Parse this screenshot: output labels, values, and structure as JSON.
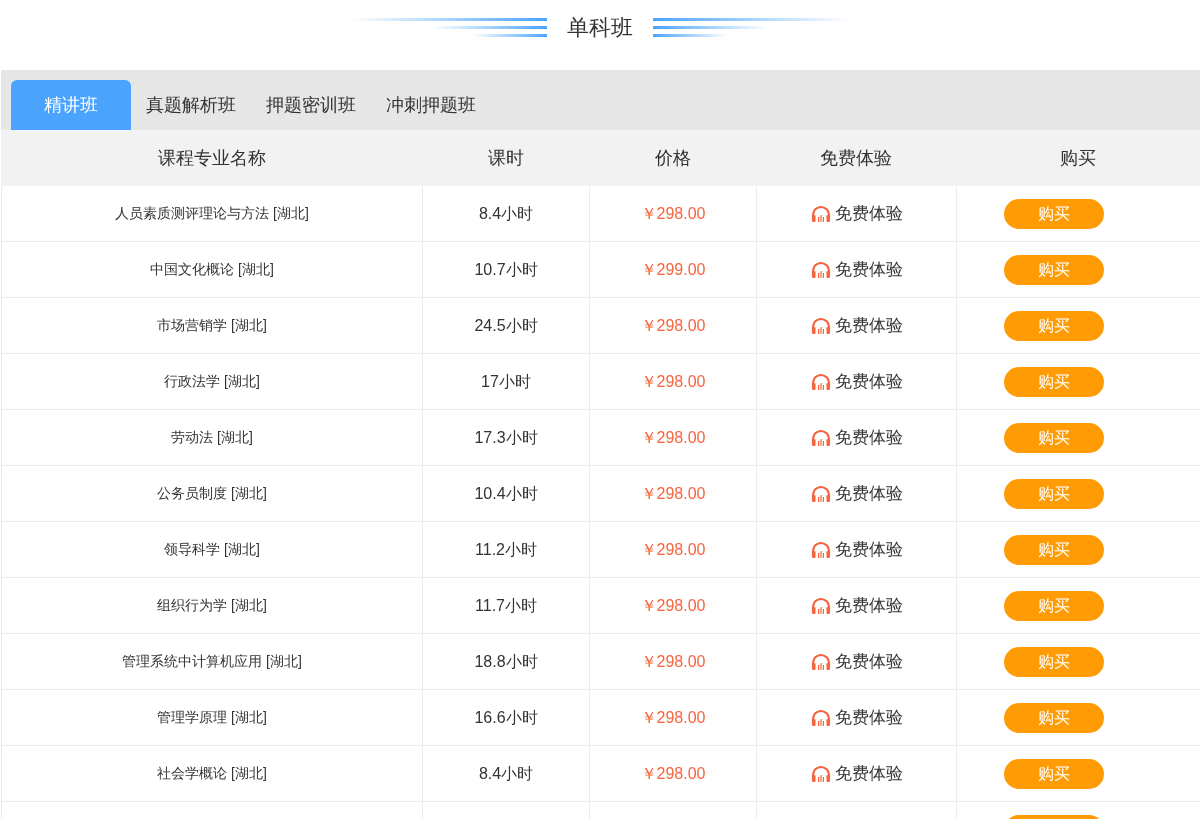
{
  "title": "单科班",
  "tabs": [
    {
      "label": "精讲班",
      "selected": true
    },
    {
      "label": "真题解析班",
      "selected": false
    },
    {
      "label": "押题密训班",
      "selected": false
    },
    {
      "label": "冲刺押题班",
      "selected": false
    }
  ],
  "table": {
    "columns": [
      "课程专业名称",
      "课时",
      "价格",
      "免费体验",
      "购买"
    ],
    "rows": [
      {
        "name": "人员素质测评理论与方法 [湖北]",
        "hours": "8.4小时",
        "price": "￥298.00",
        "trial": "免费体验",
        "buy": "购买"
      },
      {
        "name": "中国文化概论 [湖北]",
        "hours": "10.7小时",
        "price": "￥299.00",
        "trial": "免费体验",
        "buy": "购买"
      },
      {
        "name": "市场营销学 [湖北]",
        "hours": "24.5小时",
        "price": "￥298.00",
        "trial": "免费体验",
        "buy": "购买"
      },
      {
        "name": "行政法学 [湖北]",
        "hours": "17小时",
        "price": "￥298.00",
        "trial": "免费体验",
        "buy": "购买"
      },
      {
        "name": "劳动法 [湖北]",
        "hours": "17.3小时",
        "price": "￥298.00",
        "trial": "免费体验",
        "buy": "购买"
      },
      {
        "name": "公务员制度 [湖北]",
        "hours": "10.4小时",
        "price": "￥298.00",
        "trial": "免费体验",
        "buy": "购买"
      },
      {
        "name": "领导科学 [湖北]",
        "hours": "11.2小时",
        "price": "￥298.00",
        "trial": "免费体验",
        "buy": "购买"
      },
      {
        "name": "组织行为学 [湖北]",
        "hours": "11.7小时",
        "price": "￥298.00",
        "trial": "免费体验",
        "buy": "购买"
      },
      {
        "name": "管理系统中计算机应用 [湖北]",
        "hours": "18.8小时",
        "price": "￥298.00",
        "trial": "免费体验",
        "buy": "购买"
      },
      {
        "name": "管理学原理 [湖北]",
        "hours": "16.6小时",
        "price": "￥298.00",
        "trial": "免费体验",
        "buy": "购买"
      },
      {
        "name": "社会学概论 [湖北]",
        "hours": "8.4小时",
        "price": "￥298.00",
        "trial": "免费体验",
        "buy": "购买"
      }
    ]
  }
}
